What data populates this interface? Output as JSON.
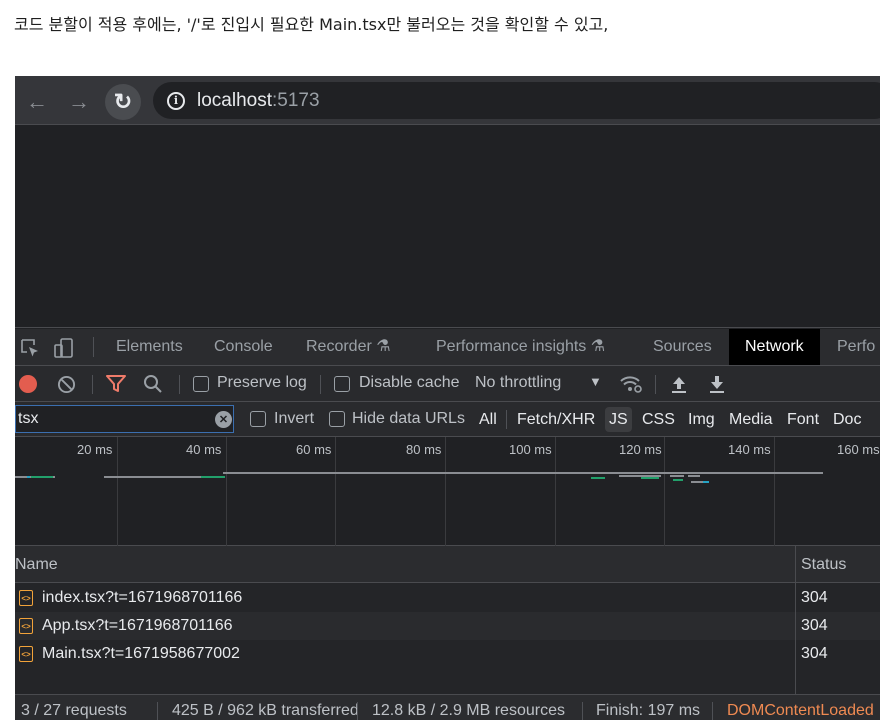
{
  "caption": "코드 분할이 적용 후에는, '/'로 진입시 필요한 Main.tsx만 불러오는 것을 확인할 수 있고,",
  "browser": {
    "url_host": "localhost",
    "url_port": ":5173"
  },
  "devtools": {
    "tabs": [
      "Elements",
      "Console",
      "Recorder",
      "Performance insights",
      "Sources",
      "Network",
      "Perfo"
    ],
    "active_tab": "Network",
    "toolbar": {
      "preserve_log": "Preserve log",
      "disable_cache": "Disable cache",
      "throttling": "No throttling"
    },
    "filter": {
      "value": "tsx",
      "invert": "Invert",
      "hide_data_urls": "Hide data URLs",
      "types": [
        "All",
        "Fetch/XHR",
        "JS",
        "CSS",
        "Img",
        "Media",
        "Font",
        "Doc"
      ],
      "selected_type": "JS"
    },
    "timeline_ticks": [
      "20 ms",
      "40 ms",
      "60 ms",
      "80 ms",
      "100 ms",
      "120 ms",
      "140 ms",
      "160 ms"
    ],
    "table": {
      "columns": [
        "Name",
        "Status"
      ],
      "rows": [
        {
          "name": "index.tsx?t=1671968701166",
          "status": "304"
        },
        {
          "name": "App.tsx?t=1671968701166",
          "status": "304"
        },
        {
          "name": "Main.tsx?t=1671958677002",
          "status": "304"
        }
      ]
    },
    "statusbar": [
      "3 / 27 requests",
      "425 B / 962 kB transferred",
      "12.8 kB / 2.9 MB resources",
      "Finish: 197 ms",
      "DOMContentLoaded"
    ]
  },
  "colors": {
    "record": "#e35d4f",
    "filter_icon": "#ef7b6a",
    "file_icon": "#f2a33a",
    "domcontentloaded": "#ef8a52"
  }
}
